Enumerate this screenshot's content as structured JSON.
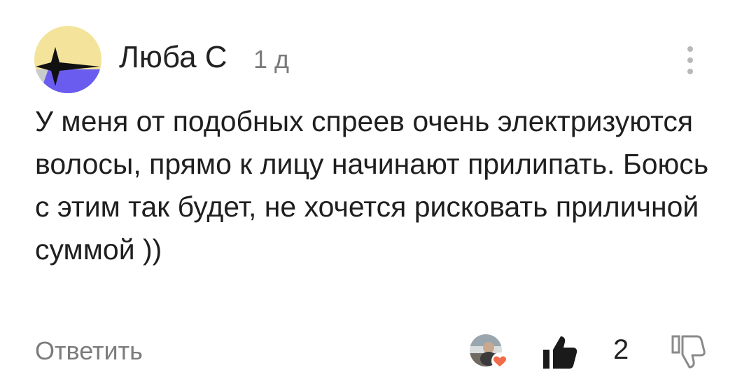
{
  "comment": {
    "author": "Люба С",
    "time": "1 д",
    "text": "У меня от подобных спреев очень электризуются волосы, прямо к лицу начинают прилипать. Боюсь с этим так будет, не хочется рисковать приличной суммой ))",
    "reply_label": "Ответить",
    "like_count": "2",
    "icons": {
      "avatar": "avatar-icon",
      "more": "more-vertical-icon",
      "liker": "liker-avatar-heart-icon",
      "like": "thumbs-up-icon",
      "dislike": "thumbs-down-icon"
    },
    "colors": {
      "avatar_yellow": "#F4E39A",
      "avatar_purple": "#6B5CF0",
      "avatar_grey": "#C8CCCA",
      "reaction_heart": "#F26B4A",
      "secondary_text": "#7C7C7C"
    }
  }
}
